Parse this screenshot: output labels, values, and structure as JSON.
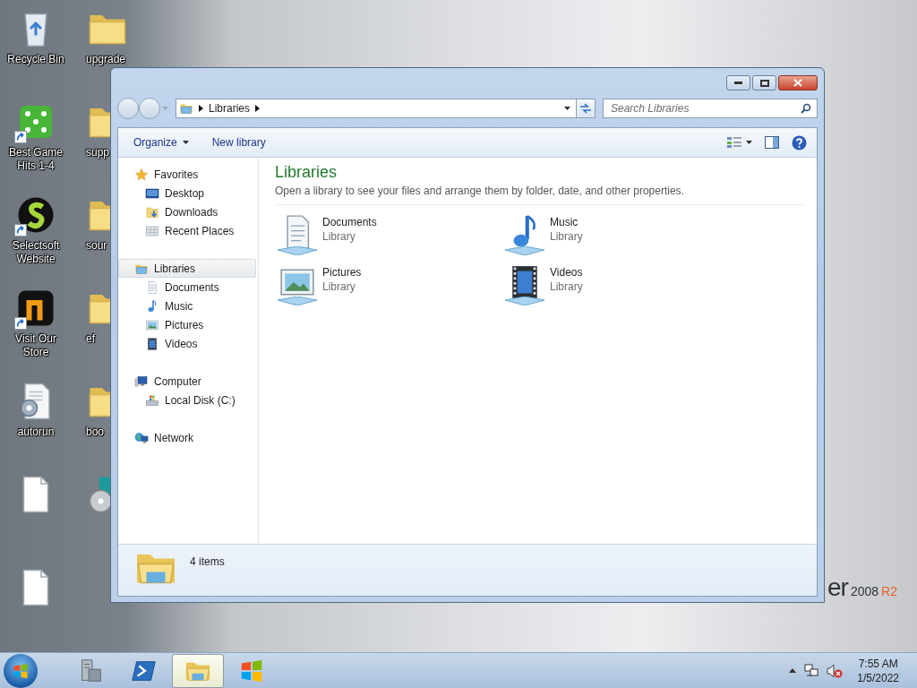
{
  "desktop": {
    "columns": [
      [
        {
          "label": "Recycle Bin",
          "kind": "recycle-bin",
          "shortcut": false
        },
        {
          "label": "Best Game Hits 1-4",
          "kind": "dice",
          "shortcut": true
        },
        {
          "label": "Selectsoft Website",
          "kind": "s-logo",
          "shortcut": true
        },
        {
          "label": "Visit Our Store",
          "kind": "store-logo",
          "shortcut": true
        },
        {
          "label": "autorun",
          "kind": "settings-file",
          "shortcut": false
        },
        {
          "kind": "file",
          "shortcut": false
        },
        {
          "kind": "file",
          "shortcut": false
        }
      ],
      [
        {
          "label": "upgrade",
          "kind": "folder",
          "shortcut": false
        },
        {
          "label": "supp",
          "kind": "folder",
          "shortcut": false
        },
        {
          "label": "sour",
          "kind": "folder",
          "shortcut": false
        },
        {
          "label": "ef",
          "kind": "folder",
          "shortcut": false
        },
        {
          "label": "boo",
          "kind": "folder",
          "shortcut": false
        },
        {
          "kind": "disc",
          "shortcut": false
        }
      ]
    ]
  },
  "wallpaper": {
    "brand": "er",
    "version": "2008",
    "edition": "R2"
  },
  "window": {
    "address": {
      "segments": [
        "Libraries"
      ]
    },
    "search": {
      "placeholder": "Search Libraries"
    },
    "toolbar": [
      {
        "label": "Organize",
        "dropdown": true
      },
      {
        "label": "New library",
        "dropdown": false
      }
    ],
    "nav": [
      {
        "label": "Favorites",
        "kind": "star",
        "selected": false,
        "children": [
          {
            "label": "Desktop",
            "kind": "desktop",
            "selected": false
          },
          {
            "label": "Downloads",
            "kind": "downloads",
            "selected": false
          },
          {
            "label": "Recent Places",
            "kind": "recent",
            "selected": false
          }
        ]
      },
      {
        "label": "Libraries",
        "kind": "library",
        "selected": true,
        "children": [
          {
            "label": "Documents",
            "kind": "documents",
            "selected": false
          },
          {
            "label": "Music",
            "kind": "music",
            "selected": false
          },
          {
            "label": "Pictures",
            "kind": "pictures",
            "selected": false
          },
          {
            "label": "Videos",
            "kind": "videos",
            "selected": false
          }
        ]
      },
      {
        "label": "Computer",
        "kind": "computer",
        "selected": false,
        "children": [
          {
            "label": "Local Disk (C:)",
            "kind": "local-disk",
            "selected": false
          }
        ]
      },
      {
        "label": "Network",
        "kind": "network",
        "selected": false
      }
    ],
    "content": {
      "title": "Libraries",
      "description": "Open a library to see your files and arrange them by folder, date, and other properties.",
      "items": [
        {
          "name": "Documents",
          "type": "Library",
          "kind": "documents"
        },
        {
          "name": "Music",
          "type": "Library",
          "kind": "music"
        },
        {
          "name": "Pictures",
          "type": "Library",
          "kind": "pictures"
        },
        {
          "name": "Videos",
          "type": "Library",
          "kind": "videos"
        }
      ]
    },
    "status": {
      "count": "4 items"
    }
  },
  "taskbar": {
    "items": [
      {
        "kind": "server-manager",
        "selected": false
      },
      {
        "kind": "powershell",
        "selected": false
      },
      {
        "kind": "explorer",
        "selected": true
      },
      {
        "kind": "windows-flag",
        "selected": false
      }
    ],
    "volume_muted": true,
    "clock": {
      "time": "7:55 AM",
      "date": "1/5/2022"
    }
  }
}
